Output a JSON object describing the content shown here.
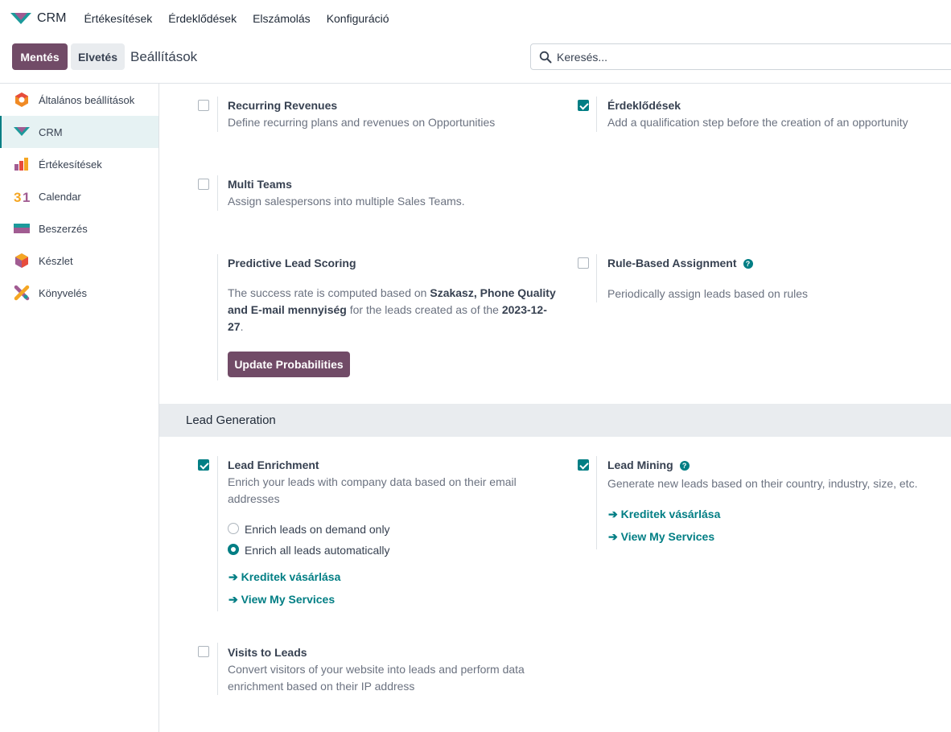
{
  "navbar": {
    "brand": "CRM",
    "menu": [
      "Értékesítések",
      "Érdeklődések",
      "Elszámolás",
      "Konfiguráció"
    ]
  },
  "control": {
    "save_label": "Mentés",
    "discard_label": "Elvetés",
    "title": "Beállítások",
    "search_placeholder": "Keresés..."
  },
  "sidebar": {
    "items": [
      {
        "label": "Általános beállítások",
        "icon": "general-settings-icon"
      },
      {
        "label": "CRM",
        "icon": "crm-icon",
        "active": true
      },
      {
        "label": "Értékesítések",
        "icon": "sales-icon"
      },
      {
        "label": "Calendar",
        "icon": "calendar-icon"
      },
      {
        "label": "Beszerzés",
        "icon": "purchase-icon"
      },
      {
        "label": "Készlet",
        "icon": "inventory-icon"
      },
      {
        "label": "Könyvelés",
        "icon": "accounting-icon"
      }
    ]
  },
  "settings": {
    "recurring": {
      "title": "Recurring Revenues",
      "desc": "Define recurring plans and revenues on Opportunities",
      "checked": false
    },
    "leads": {
      "title": "Érdeklődések",
      "desc": "Add a qualification step before the creation of an opportunity",
      "checked": true
    },
    "multi_teams": {
      "title": "Multi Teams",
      "desc": "Assign salespersons into multiple Sales Teams.",
      "checked": false
    },
    "scoring": {
      "title": "Predictive Lead Scoring",
      "desc_pre": "The success rate is computed based on ",
      "desc_fields": "Szakasz, Phone Quality and E-mail mennyiség",
      "desc_mid": " for the leads created as of the ",
      "desc_date": "2023-12-27",
      "desc_end": ".",
      "button": "Update Probabilities"
    },
    "rule_based": {
      "title": "Rule-Based Assignment",
      "desc": "Periodically assign leads based on rules",
      "checked": false,
      "help": "?"
    },
    "section_title": "Lead Generation",
    "enrichment": {
      "title": "Lead Enrichment",
      "desc": "Enrich your leads with company data based on their email addresses",
      "checked": true,
      "options": [
        {
          "label": "Enrich leads on demand only",
          "checked": false
        },
        {
          "label": "Enrich all leads automatically",
          "checked": true
        }
      ],
      "link_credits": "➔ Kreditek vásárlása",
      "link_services": "➔ View My Services"
    },
    "mining": {
      "title": "Lead Mining",
      "help": "?",
      "desc": "Generate new leads based on their country, industry, size, etc.",
      "checked": true,
      "link_credits": "➔ Kreditek vásárlása",
      "link_services": "➔ View My Services"
    },
    "visits": {
      "title": "Visits to Leads",
      "desc": "Convert visitors of your website into leads and perform data enrichment based on their IP address",
      "checked": false
    }
  },
  "colors": {
    "brand": "#714B67",
    "accent": "#017e84"
  }
}
